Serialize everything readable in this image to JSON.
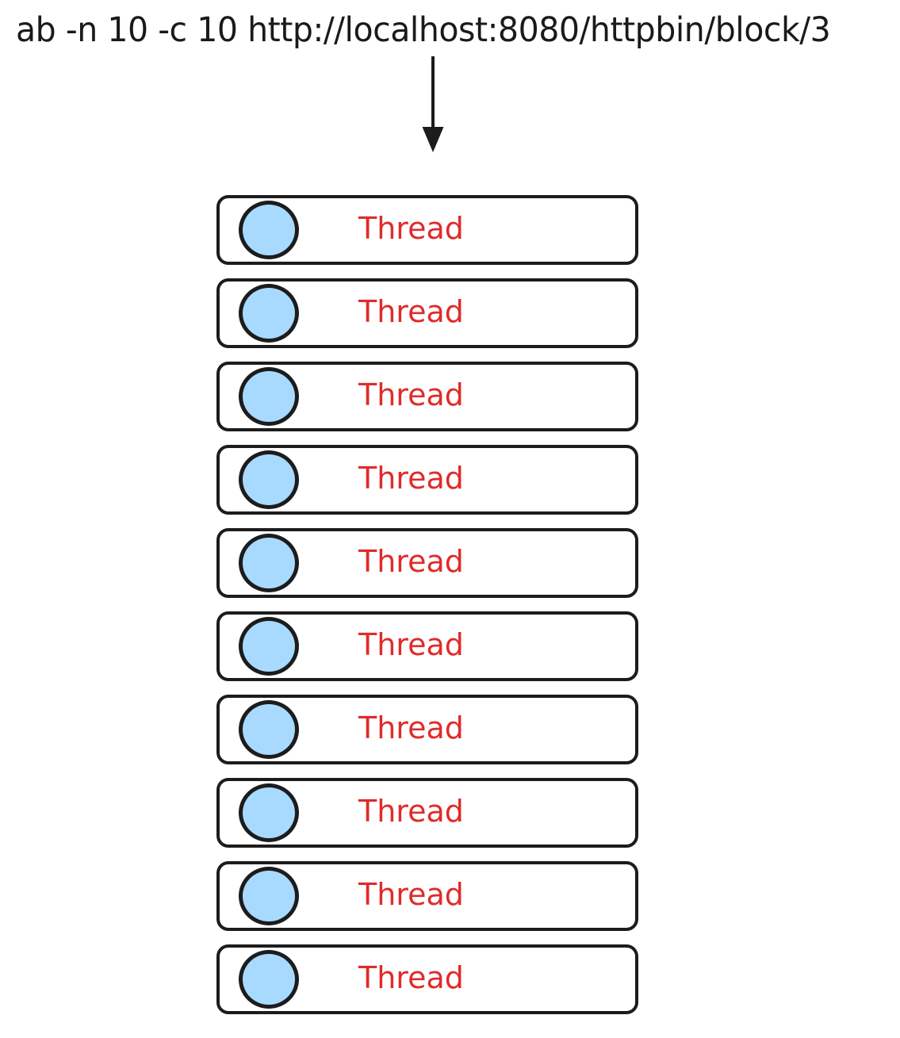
{
  "diagram": {
    "title": "ab -n 10 -c 10 http://localhost:8080/httpbin/block/3",
    "arrow": {
      "name": "down-arrow-icon",
      "direction": "down",
      "color": "#1c1c1c"
    },
    "colors": {
      "background": "#ffffff",
      "stroke": "#1c1c1c",
      "circle_fill": "#a8daff",
      "label_text": "#e02b2b",
      "title_text": "#1a1a1a"
    },
    "thread_count": 10,
    "threads": [
      {
        "label": "Thread"
      },
      {
        "label": "Thread"
      },
      {
        "label": "Thread"
      },
      {
        "label": "Thread"
      },
      {
        "label": "Thread"
      },
      {
        "label": "Thread"
      },
      {
        "label": "Thread"
      },
      {
        "label": "Thread"
      },
      {
        "label": "Thread"
      },
      {
        "label": "Thread"
      }
    ]
  }
}
